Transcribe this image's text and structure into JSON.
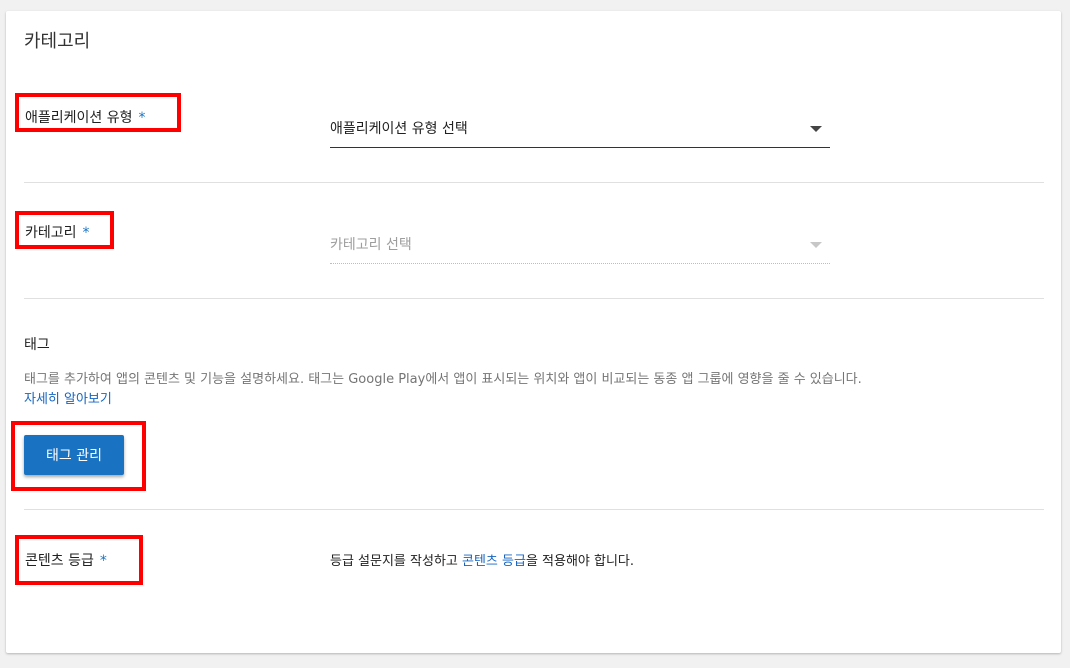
{
  "section": {
    "title": "카테고리"
  },
  "app_type": {
    "label": "애플리케이션 유형",
    "required_mark": "*",
    "select_value": "애플리케이션 유형 선택"
  },
  "category": {
    "label": "카테고리",
    "required_mark": "*",
    "select_value": "카테고리 선택"
  },
  "tags": {
    "title": "태그",
    "description": "태그를 추가하여 앱의 콘텐츠 및 기능을 설명하세요. 태그는 Google Play에서 앱이 표시되는 위치와 앱이 비교되는 동종 앱 그룹에 영향을 줄 수 있습니다.",
    "learn_more": "자세히 알아보기",
    "manage_button": "태그 관리"
  },
  "content_rating": {
    "label": "콘텐츠 등급",
    "required_mark": "*",
    "text_before": "등급 설문지를 작성하고 ",
    "link": "콘텐츠 등급",
    "text_after": "을 적용해야 합니다."
  },
  "colors": {
    "accent": "#1a73c2",
    "link": "#1565c0",
    "highlight": "#ff0000"
  }
}
